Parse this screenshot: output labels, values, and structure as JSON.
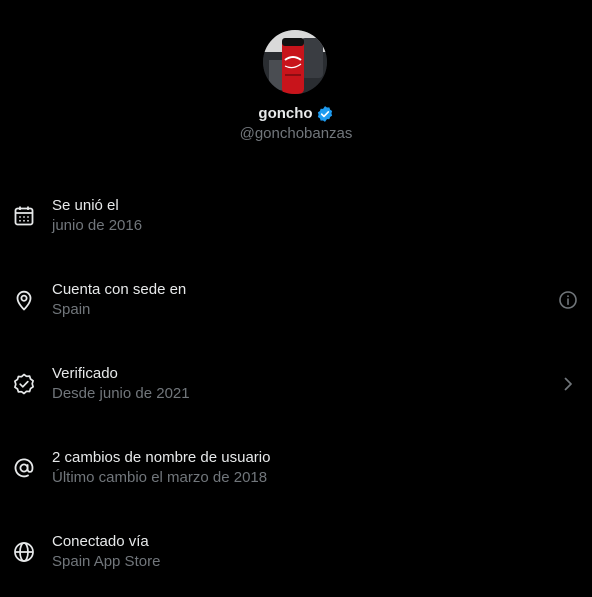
{
  "profile": {
    "display_name": "goncho",
    "handle": "@gonchobanzas",
    "verified": true,
    "avatar_icon": "avatar-photo-red-can",
    "badge_color": "#1d9bf0"
  },
  "about_rows": [
    {
      "icon": "calendar-icon",
      "title": "Se unió el",
      "subtitle": "junio de 2016",
      "action_icon": null
    },
    {
      "icon": "location-pin-icon",
      "title": "Cuenta con sede en",
      "subtitle": "Spain",
      "action_icon": "info-icon"
    },
    {
      "icon": "verified-check-icon",
      "title": "Verificado",
      "subtitle": "Desde junio de 2021",
      "action_icon": "chevron-right-icon"
    },
    {
      "icon": "at-sign-icon",
      "title": "2 cambios de nombre de usuario",
      "subtitle": "Último cambio el marzo de 2018",
      "action_icon": null
    },
    {
      "icon": "globe-icon",
      "title": "Conectado vía",
      "subtitle": "Spain App Store",
      "action_icon": null
    }
  ],
  "colors": {
    "background": "#000000",
    "primary_text": "#e7e9ea",
    "secondary_text": "#71767b",
    "accent": "#1d9bf0"
  }
}
